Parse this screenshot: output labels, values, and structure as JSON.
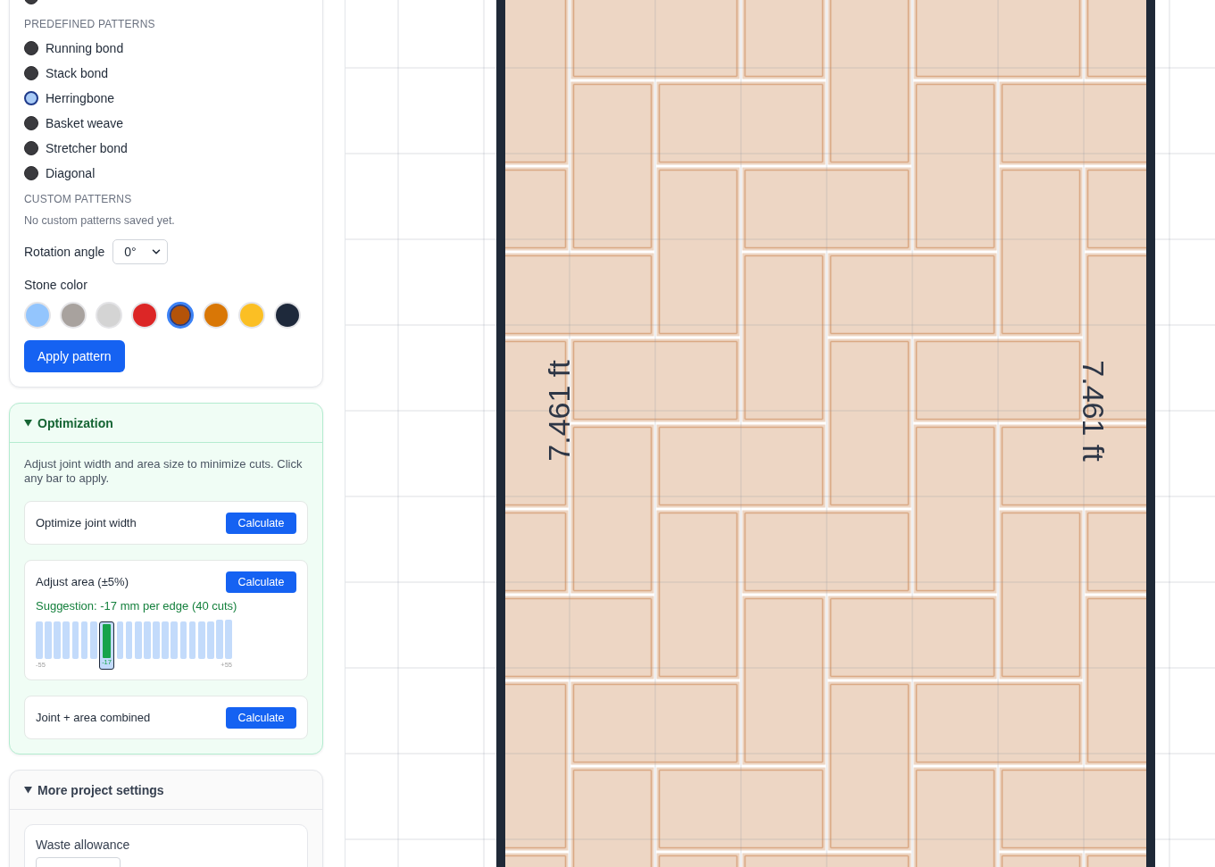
{
  "pattern_panel": {
    "default_option": {
      "selected": false
    },
    "predefined_heading": "PREDEFINED PATTERNS",
    "patterns": [
      {
        "label": "Running bond",
        "selected": false
      },
      {
        "label": "Stack bond",
        "selected": false
      },
      {
        "label": "Herringbone",
        "selected": true
      },
      {
        "label": "Basket weave",
        "selected": false
      },
      {
        "label": "Stretcher bond",
        "selected": false
      },
      {
        "label": "Diagonal",
        "selected": false
      }
    ],
    "custom_heading": "CUSTOM PATTERNS",
    "custom_empty": "No custom patterns saved yet.",
    "rotation": {
      "label": "Rotation angle",
      "value": "0°"
    },
    "stone_color": {
      "label": "Stone color",
      "swatches": [
        {
          "color": "#93c5fd",
          "selected": false
        },
        {
          "color": "#a8a29e",
          "selected": false
        },
        {
          "color": "#d4d4d4",
          "selected": false
        },
        {
          "color": "#dc2626",
          "selected": false
        },
        {
          "color": "#b45309",
          "selected": true
        },
        {
          "color": "#d97706",
          "selected": false
        },
        {
          "color": "#fbbf24",
          "selected": false
        },
        {
          "color": "#1e293b",
          "selected": false
        }
      ]
    },
    "apply_button": "Apply pattern"
  },
  "optimization": {
    "title": "Optimization",
    "expanded": true,
    "description": "Adjust joint width and area size to minimize cuts. Click any bar to apply.",
    "tools": [
      {
        "kind": "simple",
        "label": "Optimize joint width",
        "button": "Calculate"
      },
      {
        "kind": "chart",
        "label": "Adjust area (±5%)",
        "button": "Calculate",
        "suggestion": "Suggestion: -17 mm per edge (40 cuts)",
        "min_label": "-55",
        "selected_label": "-17",
        "max_label": "+55",
        "bars": [
          {
            "selected": false
          },
          {
            "selected": false
          },
          {
            "selected": false
          },
          {
            "selected": false
          },
          {
            "selected": false
          },
          {
            "selected": false
          },
          {
            "selected": false
          },
          {
            "selected": true
          },
          {
            "selected": false
          },
          {
            "selected": false
          },
          {
            "selected": false
          },
          {
            "selected": false
          },
          {
            "selected": false
          },
          {
            "selected": false
          },
          {
            "selected": false
          },
          {
            "selected": false
          },
          {
            "selected": false
          },
          {
            "selected": false
          },
          {
            "selected": false
          },
          {
            "selected": false
          },
          {
            "selected": false
          }
        ]
      },
      {
        "kind": "simple",
        "label": "Joint + area combined",
        "button": "Calculate"
      }
    ]
  },
  "project_settings": {
    "title": "More project settings",
    "expanded": true,
    "fields": [
      {
        "label": "Waste allowance"
      }
    ]
  },
  "canvas": {
    "left_dimension": "7.461 ft",
    "right_dimension": "7.461 ft"
  }
}
